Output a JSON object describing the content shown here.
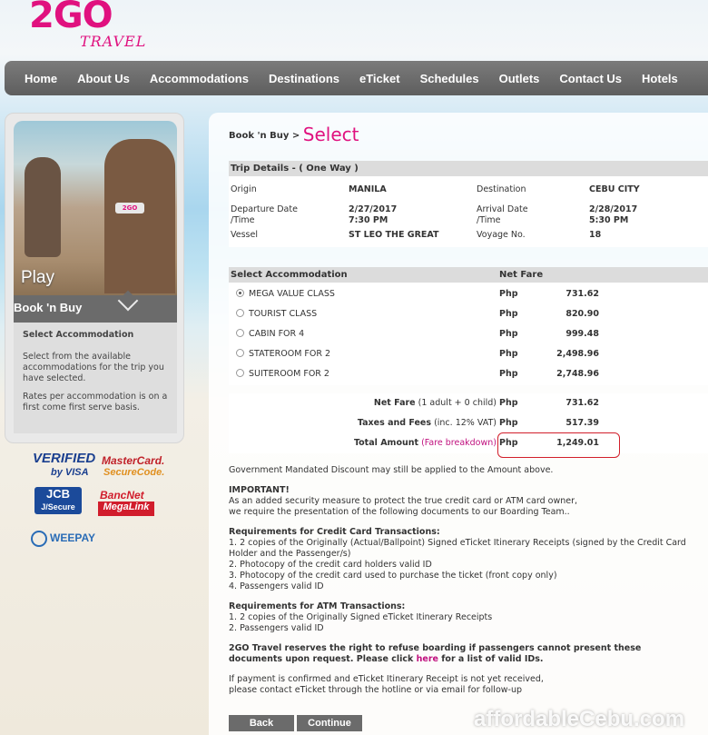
{
  "brand": {
    "logo_main": "2GO",
    "logo_sub": "TRAVEL"
  },
  "nav": [
    "Home",
    "About Us",
    "Accommodations",
    "Destinations",
    "eTicket",
    "Schedules",
    "Outlets",
    "Contact Us",
    "Hotels"
  ],
  "sidebar": {
    "photo_caption": "Play",
    "photo_band": "2GO",
    "tab_title": "Book 'n Buy",
    "heading": "Select Accommodation",
    "para1": "Select from the available accommodations for the trip you have selected.",
    "para2": "Rates per accommodation is on a first come first serve basis."
  },
  "payment_logos": {
    "verified1": "VERIFIED",
    "verified2": "by VISA",
    "mastercard1": "MasterCard.",
    "mastercard2": "SecureCode.",
    "jcb1": "JCB",
    "jcb2": "J/Secure",
    "bancnet1": "BancNet",
    "bancnet2": "MegaLink",
    "weepay": "WEEPAY"
  },
  "breadcrumb": {
    "parent": "Book 'n Buy >",
    "current": "Select"
  },
  "trip": {
    "header": "Trip Details - ( One Way )",
    "origin_label": "Origin",
    "origin": "MANILA",
    "destination_label": "Destination",
    "destination": "CEBU CITY",
    "departure_label1": "Departure Date",
    "departure_label2": "/Time",
    "departure_date": "2/27/2017",
    "departure_time": "7:30 PM",
    "arrival_label1": "Arrival Date",
    "arrival_label2": "/Time",
    "arrival_date": "2/28/2017",
    "arrival_time": "5:30 PM",
    "vessel_label": "Vessel",
    "vessel": "ST LEO THE GREAT",
    "voyage_label": "Voyage No.",
    "voyage": "18"
  },
  "accommodation": {
    "col1": "Select Accommodation",
    "col2": "Net Fare",
    "selected_index": 0,
    "rows": [
      {
        "name": "MEGA VALUE CLASS",
        "currency": "Php",
        "fare": "731.62"
      },
      {
        "name": "TOURIST CLASS",
        "currency": "Php",
        "fare": "820.90"
      },
      {
        "name": "CABIN FOR 4",
        "currency": "Php",
        "fare": "999.48"
      },
      {
        "name": "STATEROOM FOR 2",
        "currency": "Php",
        "fare": "2,498.96"
      },
      {
        "name": "SUITEROOM FOR 2",
        "currency": "Php",
        "fare": "2,748.96"
      }
    ]
  },
  "totals": {
    "net_label": "Net Fare",
    "net_note": "(1 adult + 0 child)",
    "net_currency": "Php",
    "net_value": "731.62",
    "tax_label": "Taxes and Fees",
    "tax_note": "(inc. 12% VAT)",
    "tax_currency": "Php",
    "tax_value": "517.39",
    "total_label": "Total Amount",
    "total_link": "(Fare breakdown)",
    "total_currency": "Php",
    "total_value": "1,249.01"
  },
  "notes": {
    "discount": "Government Mandated Discount may still be applied to the Amount above.",
    "important_title": "IMPORTANT!",
    "important_line1": "As an added security measure to protect the true credit card or ATM card owner,",
    "important_line2": "we require the presentation of the following documents to our Boarding Team..",
    "cc_title": "Requirements for Credit Card Transactions:",
    "cc1": "1. 2 copies of the Originally (Actual/Ballpoint) Signed eTicket Itinerary Receipts (signed by the Credit Card",
    "cc1b": "Holder and the Passenger/s)",
    "cc2": "2. Photocopy of the credit card holders valid ID",
    "cc3": "3. Photocopy of the credit card used to purchase the ticket (front copy only)",
    "cc4": "4. Passengers valid ID",
    "atm_title": "Requirements for ATM Transactions:",
    "atm1": "1. 2 copies of the Originally Signed eTicket Itinerary Receipts",
    "atm2": "2. Passengers valid ID",
    "refuse1": "2GO Travel reserves the right to refuse boarding if passengers cannot present these",
    "refuse2a": "documents upon request. Please click",
    "refuse_link": "here",
    "refuse2b": "for a list of valid IDs.",
    "followup1": "If payment is confirmed and eTicket Itinerary Receipt is not yet received,",
    "followup2": "please contact eTicket through the hotline or via email for follow-up"
  },
  "buttons": {
    "back": "Back",
    "continue": "Continue"
  },
  "watermark": "affordableCebu.com",
  "colors": {
    "brand_pink": "#e0117f",
    "nav_gray": "#6b6b6b",
    "highlight_red": "#d21f2b"
  }
}
